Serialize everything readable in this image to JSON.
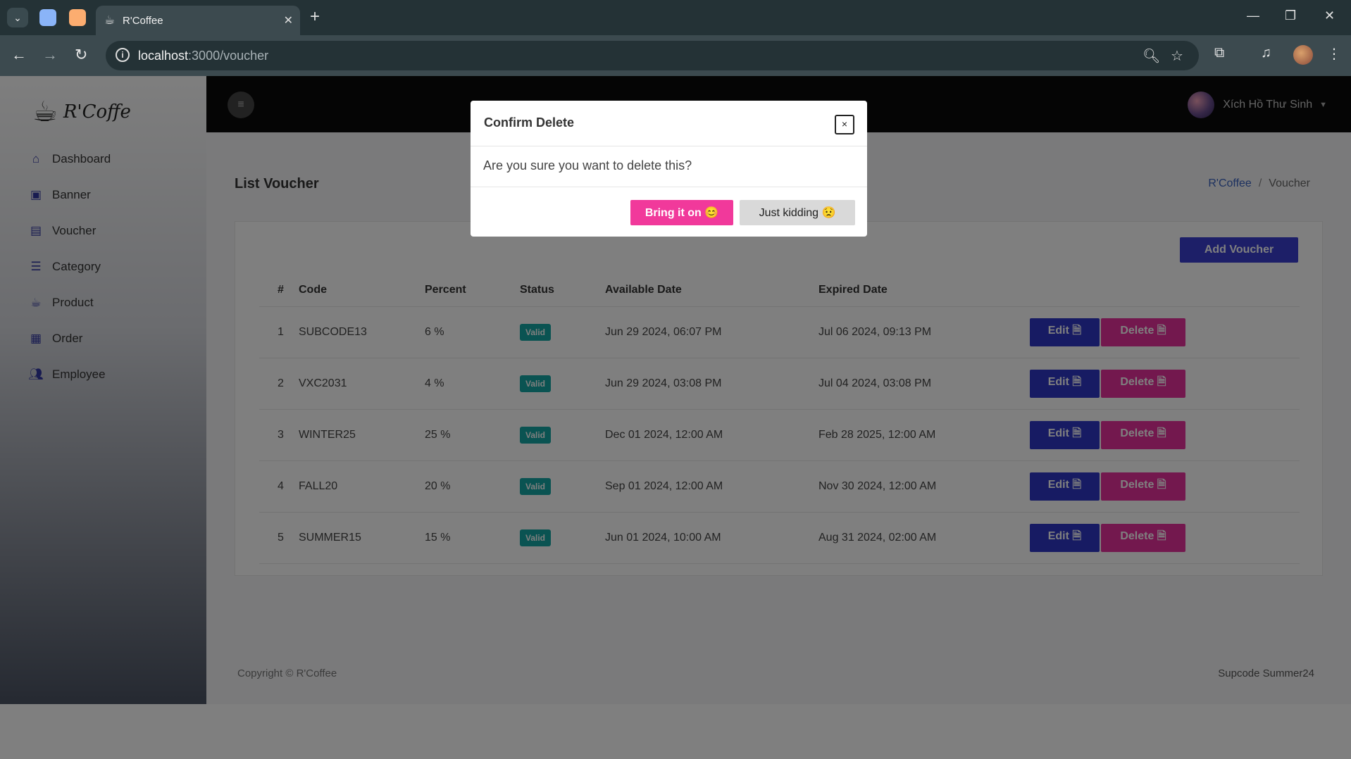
{
  "browser": {
    "tab_title": "R'Coffee",
    "url_host": "localhost",
    "url_path": ":3000/voucher",
    "tab_group_colors": [
      "#8ab4f8",
      "#fcad70"
    ]
  },
  "sidebar": {
    "logo_text": "R'Coffe",
    "items": [
      {
        "label": "Dashboard",
        "icon": "home-icon"
      },
      {
        "label": "Banner",
        "icon": "images-icon"
      },
      {
        "label": "Voucher",
        "icon": "ticket-icon"
      },
      {
        "label": "Category",
        "icon": "list-icon"
      },
      {
        "label": "Product",
        "icon": "mug-icon"
      },
      {
        "label": "Order",
        "icon": "table-icon"
      },
      {
        "label": "Employee",
        "icon": "users-icon"
      }
    ]
  },
  "topbar": {
    "user_name": "Xích Hồ Thư Sinh"
  },
  "page": {
    "title": "List Voucher",
    "breadcrumb": {
      "root": "R'Coffee",
      "separator": "/",
      "current": "Voucher"
    },
    "add_button": "Add Voucher"
  },
  "table": {
    "headers": [
      "#",
      "Code",
      "Percent",
      "Status",
      "Available Date",
      "Expired Date"
    ],
    "rows": [
      {
        "num": "1",
        "code": "SUBCODE13",
        "percent": "6 %",
        "status": "Valid",
        "available": "Jun 29 2024, 06:07 PM",
        "expired": "Jul 06 2024, 09:13 PM"
      },
      {
        "num": "2",
        "code": "VXC2031",
        "percent": "4 %",
        "status": "Valid",
        "available": "Jun 29 2024, 03:08 PM",
        "expired": "Jul 04 2024, 03:08 PM"
      },
      {
        "num": "3",
        "code": "WINTER25",
        "percent": "25 %",
        "status": "Valid",
        "available": "Dec 01 2024, 12:00 AM",
        "expired": "Feb 28 2025, 12:00 AM"
      },
      {
        "num": "4",
        "code": "FALL20",
        "percent": "20 %",
        "status": "Valid",
        "available": "Sep 01 2024, 12:00 AM",
        "expired": "Nov 30 2024, 12:00 AM"
      },
      {
        "num": "5",
        "code": "SUMMER15",
        "percent": "15 %",
        "status": "Valid",
        "available": "Jun 01 2024, 10:00 AM",
        "expired": "Aug 31 2024, 02:00 AM"
      }
    ],
    "edit_label": "Edit",
    "delete_label": "Delete"
  },
  "footer": {
    "left": "Copyright © R'Coffee",
    "right": "Supcode Summer24"
  },
  "modal": {
    "title": "Confirm Delete",
    "close": "×",
    "body": "Are you sure you want to delete this?",
    "confirm": "Bring it on 😊",
    "cancel": "Just kidding 😟"
  },
  "colors": {
    "primary": "#3a3fd0",
    "danger": "#e6319c",
    "badge": "#15a7a4"
  }
}
